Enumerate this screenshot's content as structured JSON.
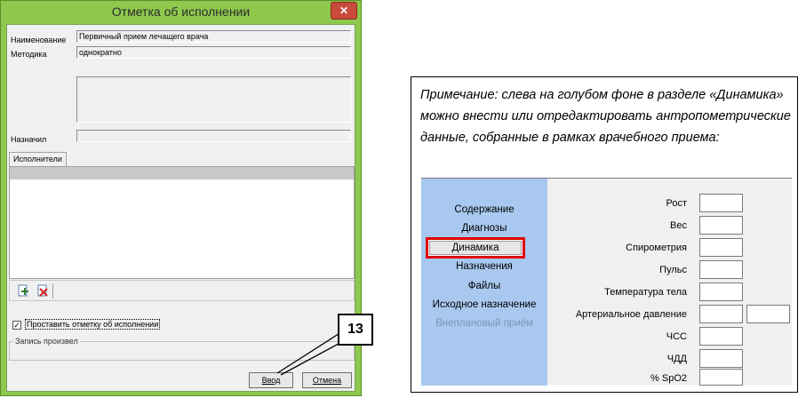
{
  "dialog": {
    "title": "Отметка об исполнении",
    "close_glyph": "✕",
    "fields": {
      "name_label": "Наименование",
      "name_value": "Первичный прием лечащего врача",
      "method_label": "Методика",
      "method_value": "однократно",
      "assigned_label": "Назначил"
    },
    "tab_label": "Исполнители",
    "toolbar_icons": [
      "add-icon",
      "delete-icon"
    ],
    "checkbox": {
      "label": "Проставить отметку об исполнении",
      "checked": true,
      "mark": "✓"
    },
    "group_label": "Запись произвел",
    "buttons": {
      "ok": "Ввод",
      "cancel": "Отмена"
    }
  },
  "callout": {
    "number": "13"
  },
  "note": {
    "text": "Примечание: слева на голубом фоне в разделе «Динамика» можно внести или отредактировать антропометрические данные,   собранные в рамках врачебного приема:"
  },
  "panel": {
    "sidebar": {
      "items": [
        {
          "label": "Содержание"
        },
        {
          "label": "Диагнозы"
        },
        {
          "label": "Динамика",
          "selected": true
        },
        {
          "label": "Назначения"
        },
        {
          "label": "Файлы"
        },
        {
          "label": "Исходное назначение"
        },
        {
          "label": "Внеплановый приём",
          "disabled": true
        }
      ]
    },
    "fields": [
      {
        "label": "Рост"
      },
      {
        "label": "Вес"
      },
      {
        "label": "Спирометрия"
      },
      {
        "label": "Пульс"
      },
      {
        "label": "Температура тела"
      },
      {
        "label": "Артериальное давление"
      },
      {
        "label": "ЧСС"
      },
      {
        "label": "ЧДД"
      },
      {
        "label": "% SpO2"
      }
    ]
  },
  "colors": {
    "title_bar": "#8ec84d",
    "sidebar_bg": "#a8c8ef",
    "highlight": "#e00000"
  }
}
